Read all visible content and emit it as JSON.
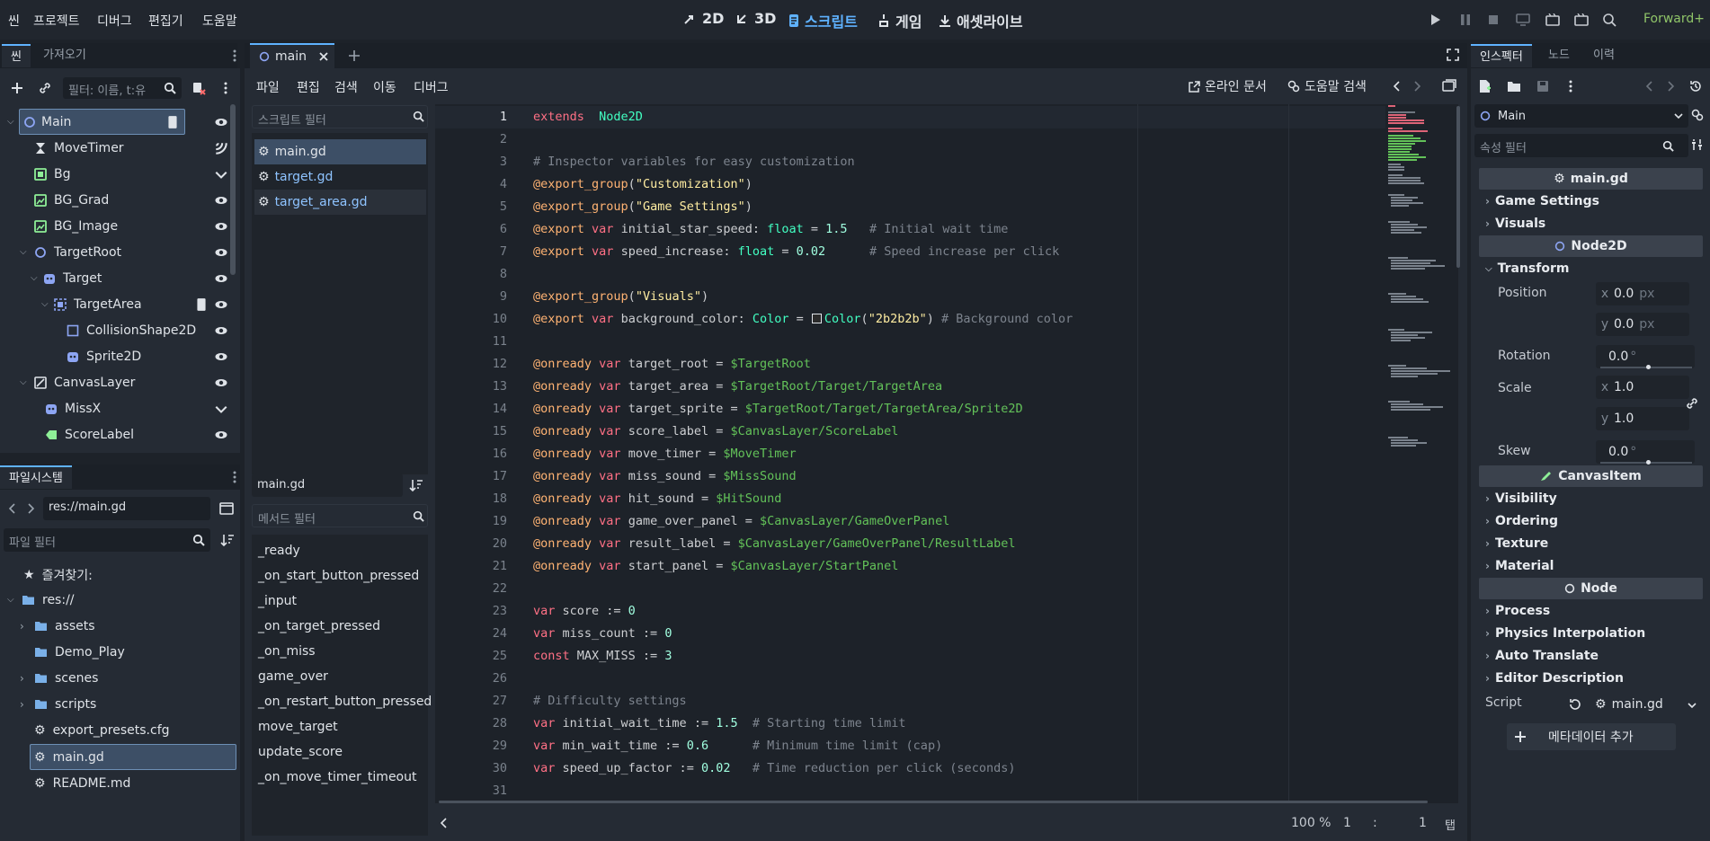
{
  "menu": [
    "씬",
    "프로젝트",
    "디버그",
    "편집기",
    "도움말"
  ],
  "workspaces": [
    {
      "label": "2D",
      "icon": "2d-icon"
    },
    {
      "label": "3D",
      "icon": "3d-icon"
    },
    {
      "label": "스크립트",
      "icon": "script-icon"
    },
    {
      "label": "게임",
      "icon": "game-icon"
    },
    {
      "label": "애셋라이브",
      "icon": "assetlib-icon"
    }
  ],
  "renderer": "Forward+",
  "scene_dock": {
    "tabs": [
      "씬",
      "가져오기"
    ],
    "filter_placeholder": "필터: 이름, t:유",
    "nodes": [
      {
        "name": "Main",
        "icon": "node2d-icon"
      },
      {
        "name": "MoveTimer",
        "icon": "timer-icon"
      },
      {
        "name": "Bg",
        "icon": "colorrect-icon"
      },
      {
        "name": "BG_Grad",
        "icon": "texturerect-icon"
      },
      {
        "name": "BG_Image",
        "icon": "texturerect-icon"
      },
      {
        "name": "TargetRoot",
        "icon": "node2d-icon"
      },
      {
        "name": "Target",
        "icon": "sprite-icon"
      },
      {
        "name": "TargetArea",
        "icon": "area2d-icon"
      },
      {
        "name": "CollisionShape2D",
        "icon": "collision-icon"
      },
      {
        "name": "Sprite2D",
        "icon": "sprite-icon"
      },
      {
        "name": "CanvasLayer",
        "icon": "canvaslayer-icon"
      },
      {
        "name": "MissX",
        "icon": "sprite-icon"
      },
      {
        "name": "ScoreLabel",
        "icon": "label-icon"
      }
    ]
  },
  "filesystem": {
    "tab": "파일시스템",
    "path": "res://main.gd",
    "filter_placeholder": "파일 필터",
    "favorites": "즐겨찾기:",
    "root": "res://",
    "items": [
      "assets",
      "Demo_Play",
      "scenes",
      "scripts",
      "export_presets.cfg",
      "main.gd",
      "README.md"
    ]
  },
  "script_editor": {
    "tab": "main",
    "menus": [
      "파일",
      "편집",
      "검색",
      "이동",
      "디버그"
    ],
    "online_docs": "온라인 문서",
    "help_search": "도움말 검색",
    "script_filter_placeholder": "스크립트 필터",
    "scripts": [
      "main.gd",
      "target.gd",
      "target_area.gd"
    ],
    "current_script": "main.gd",
    "method_filter_placeholder": "메서드 필터",
    "methods": [
      "_ready",
      "_on_start_button_pressed",
      "_input",
      "_on_target_pressed",
      "_on_miss",
      "game_over",
      "_on_restart_button_pressed",
      "move_target",
      "update_score",
      "_on_move_timer_timeout"
    ],
    "zoom": "100 %",
    "line": "1",
    "col": "1",
    "indent": "탭"
  },
  "code_lines": [
    {
      "n": "1",
      "segs": [
        [
          "kw",
          "extends"
        ],
        [
          "",
          "  "
        ],
        [
          "typ",
          "Node2D"
        ]
      ]
    },
    {
      "n": "2",
      "segs": []
    },
    {
      "n": "3",
      "segs": [
        [
          "cmt",
          "# Inspector variables for easy customization"
        ]
      ]
    },
    {
      "n": "4",
      "segs": [
        [
          "ann",
          "@export_group"
        ],
        [
          "",
          "("
        ],
        [
          "str",
          "\"Customization\""
        ],
        [
          "",
          ")"
        ]
      ]
    },
    {
      "n": "5",
      "segs": [
        [
          "ann",
          "@export_group"
        ],
        [
          "",
          "("
        ],
        [
          "str",
          "\"Game Settings\""
        ],
        [
          "",
          ")"
        ]
      ]
    },
    {
      "n": "6",
      "segs": [
        [
          "ann",
          "@export"
        ],
        [
          "",
          " "
        ],
        [
          "kw",
          "var"
        ],
        [
          "",
          " initial_star_speed: "
        ],
        [
          "typ",
          "float"
        ],
        [
          "",
          " = "
        ],
        [
          "num",
          "1.5"
        ],
        [
          "",
          "   "
        ],
        [
          "cmt",
          "# Initial wait time"
        ]
      ]
    },
    {
      "n": "7",
      "segs": [
        [
          "ann",
          "@export"
        ],
        [
          "",
          " "
        ],
        [
          "kw",
          "var"
        ],
        [
          "",
          " speed_increase: "
        ],
        [
          "typ",
          "float"
        ],
        [
          "",
          " = "
        ],
        [
          "num",
          "0.02"
        ],
        [
          "",
          "      "
        ],
        [
          "cmt",
          "# Speed increase per click"
        ]
      ]
    },
    {
      "n": "8",
      "segs": []
    },
    {
      "n": "9",
      "segs": [
        [
          "ann",
          "@export_group"
        ],
        [
          "",
          "("
        ],
        [
          "str",
          "\"Visuals\""
        ],
        [
          "",
          ")"
        ]
      ]
    },
    {
      "n": "10",
      "segs": [
        [
          "ann",
          "@export"
        ],
        [
          "",
          " "
        ],
        [
          "kw",
          "var"
        ],
        [
          "",
          " background_color: "
        ],
        [
          "typ",
          "Color"
        ],
        [
          "",
          " = "
        ],
        [
          "swatch",
          ""
        ],
        [
          "typ",
          "Color"
        ],
        [
          "",
          "("
        ],
        [
          "str",
          "\"2b2b2b\""
        ],
        [
          "",
          ") "
        ],
        [
          "cmt",
          "# Background color"
        ]
      ]
    },
    {
      "n": "11",
      "segs": []
    },
    {
      "n": "12",
      "segs": [
        [
          "ann",
          "@onready"
        ],
        [
          "",
          " "
        ],
        [
          "kw",
          "var"
        ],
        [
          "",
          " target_root = "
        ],
        [
          "nodepath",
          "$TargetRoot"
        ]
      ]
    },
    {
      "n": "13",
      "segs": [
        [
          "ann",
          "@onready"
        ],
        [
          "",
          " "
        ],
        [
          "kw",
          "var"
        ],
        [
          "",
          " target_area = "
        ],
        [
          "nodepath",
          "$TargetRoot/Target/TargetArea"
        ]
      ]
    },
    {
      "n": "14",
      "segs": [
        [
          "ann",
          "@onready"
        ],
        [
          "",
          " "
        ],
        [
          "kw",
          "var"
        ],
        [
          "",
          " target_sprite = "
        ],
        [
          "nodepath",
          "$TargetRoot/Target/TargetArea/Sprite2D"
        ]
      ]
    },
    {
      "n": "15",
      "segs": [
        [
          "ann",
          "@onready"
        ],
        [
          "",
          " "
        ],
        [
          "kw",
          "var"
        ],
        [
          "",
          " score_label = "
        ],
        [
          "nodepath",
          "$CanvasLayer/ScoreLabel"
        ]
      ]
    },
    {
      "n": "16",
      "segs": [
        [
          "ann",
          "@onready"
        ],
        [
          "",
          " "
        ],
        [
          "kw",
          "var"
        ],
        [
          "",
          " move_timer = "
        ],
        [
          "nodepath",
          "$MoveTimer"
        ]
      ]
    },
    {
      "n": "17",
      "segs": [
        [
          "ann",
          "@onready"
        ],
        [
          "",
          " "
        ],
        [
          "kw",
          "var"
        ],
        [
          "",
          " miss_sound = "
        ],
        [
          "nodepath",
          "$MissSound"
        ]
      ]
    },
    {
      "n": "18",
      "segs": [
        [
          "ann",
          "@onready"
        ],
        [
          "",
          " "
        ],
        [
          "kw",
          "var"
        ],
        [
          "",
          " hit_sound = "
        ],
        [
          "nodepath",
          "$HitSound"
        ]
      ]
    },
    {
      "n": "19",
      "segs": [
        [
          "ann",
          "@onready"
        ],
        [
          "",
          " "
        ],
        [
          "kw",
          "var"
        ],
        [
          "",
          " game_over_panel = "
        ],
        [
          "nodepath",
          "$CanvasLayer/GameOverPanel"
        ]
      ]
    },
    {
      "n": "20",
      "segs": [
        [
          "ann",
          "@onready"
        ],
        [
          "",
          " "
        ],
        [
          "kw",
          "var"
        ],
        [
          "",
          " result_label = "
        ],
        [
          "nodepath",
          "$CanvasLayer/GameOverPanel/ResultLabel"
        ]
      ]
    },
    {
      "n": "21",
      "segs": [
        [
          "ann",
          "@onready"
        ],
        [
          "",
          " "
        ],
        [
          "kw",
          "var"
        ],
        [
          "",
          " start_panel = "
        ],
        [
          "nodepath",
          "$CanvasLayer/StartPanel"
        ]
      ]
    },
    {
      "n": "22",
      "segs": []
    },
    {
      "n": "23",
      "segs": [
        [
          "kw",
          "var"
        ],
        [
          "",
          " score := "
        ],
        [
          "num",
          "0"
        ]
      ]
    },
    {
      "n": "24",
      "segs": [
        [
          "kw",
          "var"
        ],
        [
          "",
          " miss_count := "
        ],
        [
          "num",
          "0"
        ]
      ]
    },
    {
      "n": "25",
      "segs": [
        [
          "kw",
          "const"
        ],
        [
          "",
          " MAX_MISS := "
        ],
        [
          "num",
          "3"
        ]
      ]
    },
    {
      "n": "26",
      "segs": []
    },
    {
      "n": "27",
      "segs": [
        [
          "cmt",
          "# Difficulty settings"
        ]
      ]
    },
    {
      "n": "28",
      "segs": [
        [
          "kw",
          "var"
        ],
        [
          "",
          " initial_wait_time := "
        ],
        [
          "num",
          "1.5"
        ],
        [
          "",
          "  "
        ],
        [
          "cmt",
          "# Starting time limit"
        ]
      ]
    },
    {
      "n": "29",
      "segs": [
        [
          "kw",
          "var"
        ],
        [
          "",
          " min_wait_time := "
        ],
        [
          "num",
          "0.6"
        ],
        [
          "",
          "      "
        ],
        [
          "cmt",
          "# Minimum time limit (cap)"
        ]
      ]
    },
    {
      "n": "30",
      "segs": [
        [
          "kw",
          "var"
        ],
        [
          "",
          " speed_up_factor := "
        ],
        [
          "num",
          "0.02"
        ],
        [
          "",
          "   "
        ],
        [
          "cmt",
          "# Time reduction per click (seconds)"
        ]
      ]
    },
    {
      "n": "31",
      "segs": []
    }
  ],
  "inspector": {
    "tabs": [
      "인스펙터",
      "노드",
      "이력"
    ],
    "node": "Main",
    "filter_placeholder": "속성 필터",
    "script_header": "main.gd",
    "script_sections": [
      "Game Settings",
      "Visuals"
    ],
    "node2d_header": "Node2D",
    "transform": "Transform",
    "position_label": "Position",
    "position_x": "0.0",
    "position_y": "0.0",
    "unit_px": "px",
    "rotation_label": "Rotation",
    "rotation": "0.0",
    "deg": "°",
    "scale_label": "Scale",
    "scale_x": "1.0",
    "scale_y": "1.0",
    "skew_label": "Skew",
    "skew": "0.0",
    "canvasitem_header": "CanvasItem",
    "canvasitem_sections": [
      "Visibility",
      "Ordering",
      "Texture",
      "Material"
    ],
    "node_header": "Node",
    "node_sections": [
      "Process",
      "Physics Interpolation",
      "Auto Translate",
      "Editor Description"
    ],
    "script_label": "Script",
    "script_value": "main.gd",
    "add_metadata": "메타데이터 추가"
  },
  "colors": {
    "accent": "#5fb2ff",
    "renderer": "#8fc468",
    "selection": "#3d4f66"
  }
}
